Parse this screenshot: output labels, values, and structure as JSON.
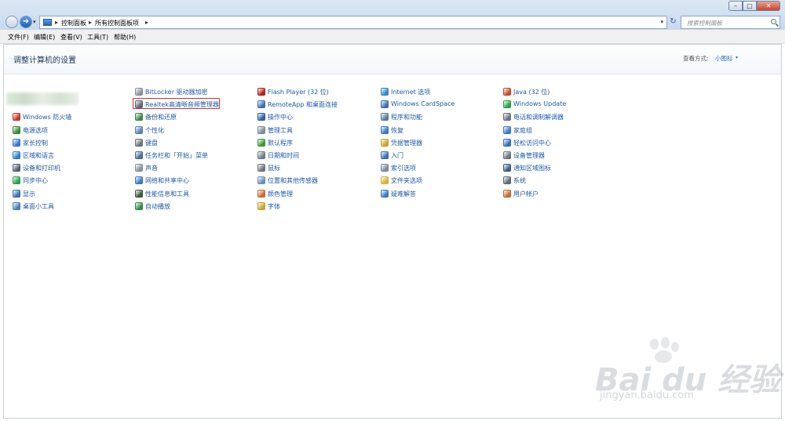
{
  "window": {
    "minimize": "–",
    "maximize": "□",
    "close": "✕"
  },
  "address": {
    "crumbs": [
      "控制面板",
      "所有控制面板项"
    ],
    "separator": "▸",
    "dropdown": "▾",
    "refresh": "↻"
  },
  "search": {
    "placeholder": "搜索控制面板"
  },
  "menu": [
    "文件(F)",
    "编辑(E)",
    "查看(V)",
    "工具(T)",
    "帮助(H)"
  ],
  "header": {
    "title": "调整计算机的设置",
    "view_label": "查看方式:",
    "view_value": "小图标",
    "view_arrow": "▾"
  },
  "columns": [
    {
      "items": [
        {
          "label": "",
          "icon": "blurred-icon",
          "color": "#ffffff"
        },
        {
          "label": "",
          "icon": "blurred-icon",
          "color": "#ffffff"
        },
        {
          "label": "Windows 防火墙",
          "icon": "firewall-icon",
          "color": "#c0392b"
        },
        {
          "label": "电源选项",
          "icon": "power-icon",
          "color": "#3a8a3a"
        },
        {
          "label": "家长控制",
          "icon": "parental-controls-icon",
          "color": "#3a78c8"
        },
        {
          "label": "区域和语言",
          "icon": "globe-icon",
          "color": "#2f7fc0"
        },
        {
          "label": "设备和打印机",
          "icon": "printer-icon",
          "color": "#555f6e"
        },
        {
          "label": "同步中心",
          "icon": "sync-icon",
          "color": "#2aa04a"
        },
        {
          "label": "显示",
          "icon": "display-icon",
          "color": "#3a6fb0"
        },
        {
          "label": "桌面小工具",
          "icon": "gadgets-icon",
          "color": "#4a7fb8"
        }
      ]
    },
    {
      "items": [
        {
          "label": "BitLocker 驱动器加密",
          "icon": "bitlocker-icon",
          "color": "#8a8f98"
        },
        {
          "label": "Realtek高清晰音频管理器",
          "icon": "realtek-audio-icon",
          "color": "#5a6878"
        },
        {
          "label": "备份和还原",
          "icon": "backup-icon",
          "color": "#3a8a4a"
        },
        {
          "label": "个性化",
          "icon": "personalization-icon",
          "color": "#5a7fc0"
        },
        {
          "label": "键盘",
          "icon": "keyboard-icon",
          "color": "#6d737c"
        },
        {
          "label": "任务栏和「开始」菜单",
          "icon": "taskbar-icon",
          "color": "#4a6a9a"
        },
        {
          "label": "声音",
          "icon": "sound-icon",
          "color": "#8a8f98"
        },
        {
          "label": "网络和共享中心",
          "icon": "network-icon",
          "color": "#3a78c8"
        },
        {
          "label": "性能信息和工具",
          "icon": "performance-icon",
          "color": "#3a5a3a"
        },
        {
          "label": "自动播放",
          "icon": "autoplay-icon",
          "color": "#2f8a4a"
        }
      ]
    },
    {
      "items": [
        {
          "label": "Flash Player (32 位)",
          "icon": "flash-icon",
          "color": "#b0201e"
        },
        {
          "label": "RemoteApp 和桌面连接",
          "icon": "remoteapp-icon",
          "color": "#3a6fb0"
        },
        {
          "label": "操作中心",
          "icon": "action-center-icon",
          "color": "#2f5fa8"
        },
        {
          "label": "管理工具",
          "icon": "admin-tools-icon",
          "color": "#7a8a9a"
        },
        {
          "label": "默认程序",
          "icon": "default-programs-icon",
          "color": "#3a9a3a"
        },
        {
          "label": "日期和时间",
          "icon": "clock-icon",
          "color": "#6d7c8c"
        },
        {
          "label": "鼠标",
          "icon": "mouse-icon",
          "color": "#6d737c"
        },
        {
          "label": "位置和其他传感器",
          "icon": "sensor-icon",
          "color": "#6a8fb0"
        },
        {
          "label": "颜色管理",
          "icon": "color-management-icon",
          "color": "#c86a2a"
        },
        {
          "label": "字体",
          "icon": "font-icon",
          "color": "#c9a32a"
        }
      ]
    },
    {
      "items": [
        {
          "label": "Internet 选项",
          "icon": "internet-options-icon",
          "color": "#2f8ac0"
        },
        {
          "label": "Windows CardSpace",
          "icon": "cardspace-icon",
          "color": "#3a6fb0"
        },
        {
          "label": "程序和功能",
          "icon": "programs-icon",
          "color": "#5a7a9a"
        },
        {
          "label": "恢复",
          "icon": "recovery-icon",
          "color": "#3a78c8"
        },
        {
          "label": "凭据管理器",
          "icon": "credential-icon",
          "color": "#c9a32a"
        },
        {
          "label": "入门",
          "icon": "getting-started-icon",
          "color": "#3a6fb0"
        },
        {
          "label": "索引选项",
          "icon": "indexing-icon",
          "color": "#7a8a9a"
        },
        {
          "label": "文件夹选项",
          "icon": "folder-options-icon",
          "color": "#d9b03a"
        },
        {
          "label": "疑难解答",
          "icon": "troubleshooting-icon",
          "color": "#3a78c8"
        }
      ]
    },
    {
      "items": [
        {
          "label": "Java (32 位)",
          "icon": "java-icon",
          "color": "#c84a2a"
        },
        {
          "label": "Windows Update",
          "icon": "windows-update-icon",
          "color": "#2aa04a"
        },
        {
          "label": "电话和调制解调器",
          "icon": "phone-modem-icon",
          "color": "#6d737c"
        },
        {
          "label": "家庭组",
          "icon": "homegroup-icon",
          "color": "#3a78c8"
        },
        {
          "label": "轻松访问中心",
          "icon": "ease-of-access-icon",
          "color": "#2f6fc0"
        },
        {
          "label": "设备管理器",
          "icon": "device-manager-icon",
          "color": "#6d737c"
        },
        {
          "label": "通知区域图标",
          "icon": "notification-icon",
          "color": "#3a5a8a"
        },
        {
          "label": "系统",
          "icon": "system-icon",
          "color": "#5a6a7a"
        },
        {
          "label": "用户帐户",
          "icon": "user-accounts-icon",
          "color": "#c86a2a"
        }
      ]
    }
  ],
  "watermark": {
    "brand": "Bai du 经验",
    "url": "jingyan.baidu.com"
  }
}
